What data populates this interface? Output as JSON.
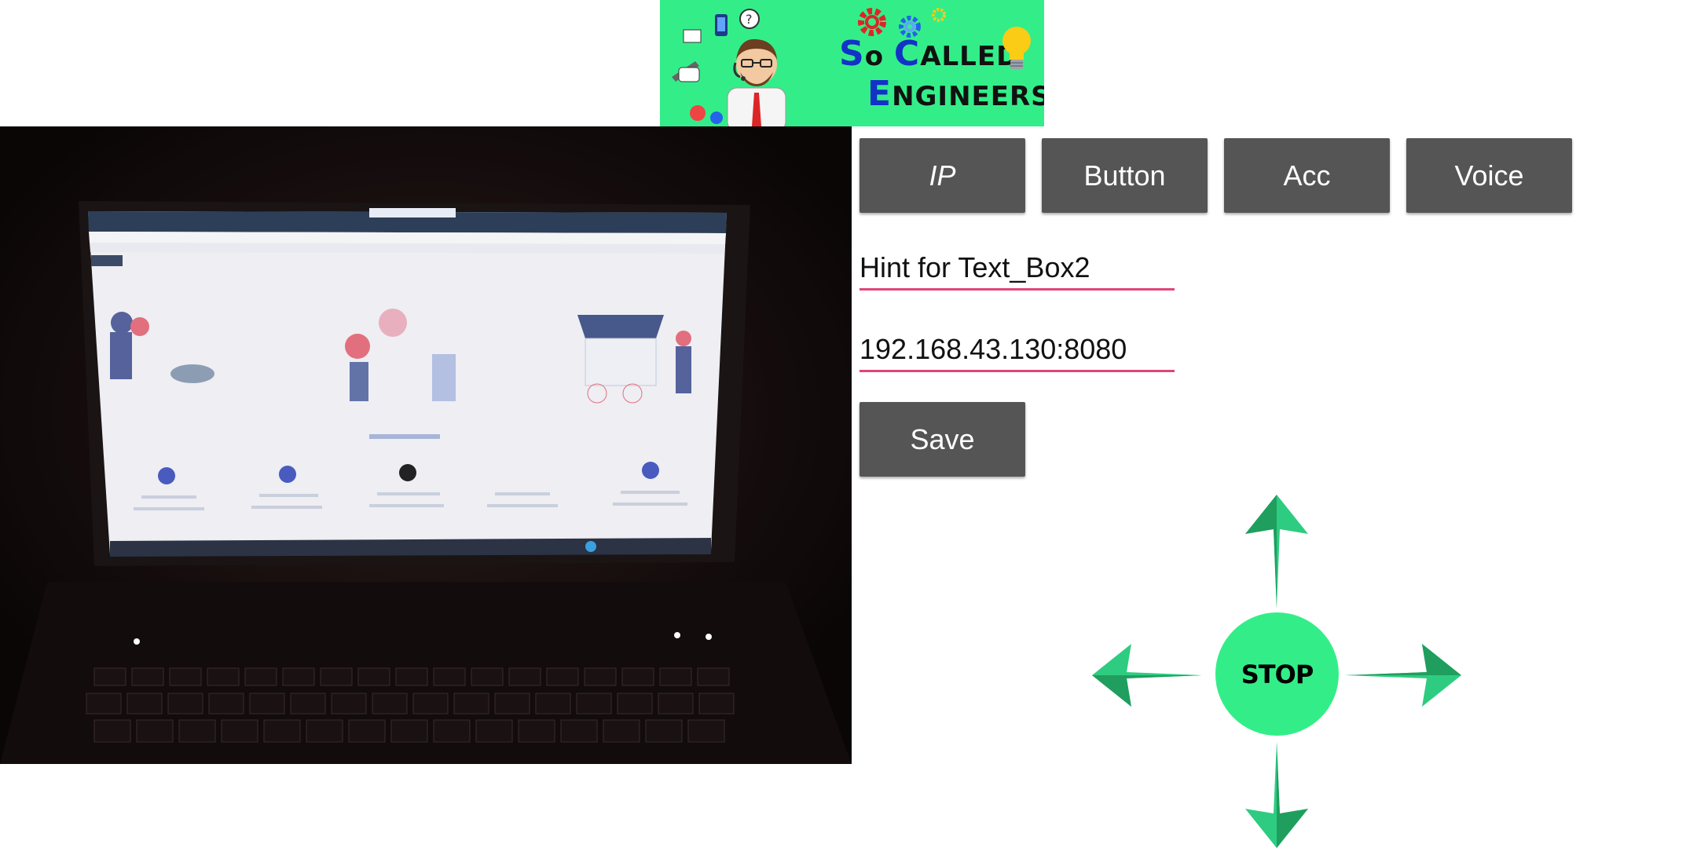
{
  "logo": {
    "line1_cap1": "S",
    "line1_rest1": "o ",
    "line1_cap2": "C",
    "line1_rest2": "alled",
    "line2_cap": "E",
    "line2_rest": "ngineers"
  },
  "toolbar": {
    "ip_label": "IP",
    "button_label": "Button",
    "acc_label": "Acc",
    "voice_label": "Voice"
  },
  "fields": {
    "text_box2_placeholder": "Hint for Text_Box2",
    "ip_value": "192.168.43.130:8080"
  },
  "save_label": "Save",
  "dpad": {
    "stop_label": "STOP",
    "arrow_color": "#2ecc80",
    "stop_color": "#33ee88"
  },
  "colors": {
    "button_bg": "#555555",
    "field_underline": "#e0457b",
    "logo_bg": "#33ee88"
  }
}
